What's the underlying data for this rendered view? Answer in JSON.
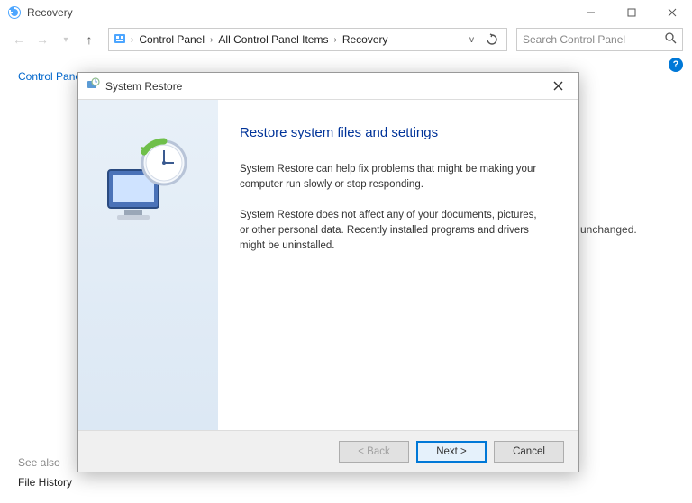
{
  "window": {
    "title": "Recovery",
    "min_label": "Minimize",
    "max_label": "Maximize",
    "close_label": "Close"
  },
  "nav": {
    "back_label": "Back",
    "forward_label": "Forward",
    "up_label": "Up"
  },
  "breadcrumb": {
    "items": [
      "Control Panel",
      "All Control Panel Items",
      "Recovery"
    ]
  },
  "search": {
    "placeholder": "Search Control Panel"
  },
  "sidebar": {
    "home_label": "Control Panel Home",
    "see_also_label": "See also",
    "file_history_label": "File History"
  },
  "page": {
    "bg_snippet": "ic unchanged."
  },
  "help": {
    "badge": "?"
  },
  "dialog": {
    "title": "System Restore",
    "close_label": "Close",
    "heading": "Restore system files and settings",
    "paragraph1": "System Restore can help fix problems that might be making your computer run slowly or stop responding.",
    "paragraph2": "System Restore does not affect any of your documents, pictures, or other personal data. Recently installed programs and drivers might be uninstalled.",
    "buttons": {
      "back": "< Back",
      "next": "Next >",
      "cancel": "Cancel"
    }
  }
}
